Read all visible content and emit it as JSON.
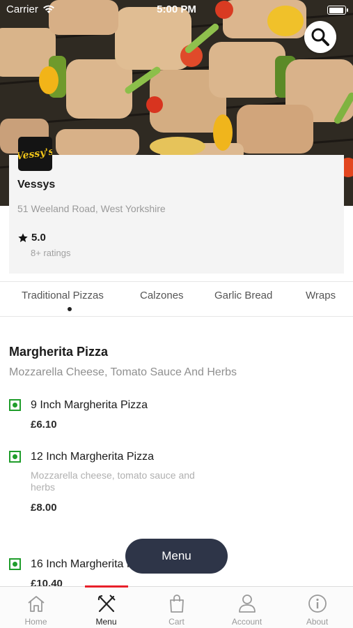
{
  "status_bar": {
    "carrier": "Carrier",
    "time": "5:00 PM"
  },
  "restaurant": {
    "logo_text": "Vessy's",
    "name": "Vessys",
    "address": "51 Weeland Road, West Yorkshire",
    "rating": "5.0",
    "ratings_count": "8+ ratings"
  },
  "tabs": [
    {
      "label": "Traditional Pizzas",
      "active": true
    },
    {
      "label": "Calzones"
    },
    {
      "label": "Garlic Bread"
    },
    {
      "label": "Wraps"
    }
  ],
  "category": {
    "title": "Margherita Pizza",
    "description": "Mozzarella Cheese, Tomato  Sauce And Herbs",
    "items": [
      {
        "name": "9 Inch Margherita Pizza",
        "price": "£6.10"
      },
      {
        "name": "12 Inch Margherita Pizza",
        "description": "Mozzarella cheese, tomato sauce and herbs",
        "price": "£8.00"
      },
      {
        "name": "16 Inch Margherita Pizza",
        "price": "£10.40"
      }
    ]
  },
  "menu_button": "Menu",
  "bottom_nav": [
    {
      "label": "Home",
      "icon": "home-icon"
    },
    {
      "label": "Menu",
      "icon": "fork-knife-icon",
      "active": true
    },
    {
      "label": "Cart",
      "icon": "shopping-bag-icon"
    },
    {
      "label": "Account",
      "icon": "user-icon"
    },
    {
      "label": "About",
      "icon": "info-icon"
    }
  ],
  "colors": {
    "accent": "#e8202a",
    "veg": "#1f9d2b",
    "fab": "#2e3548"
  }
}
